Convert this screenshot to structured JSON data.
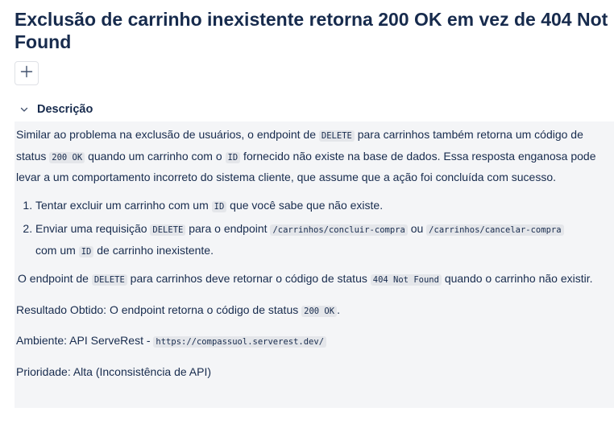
{
  "issue": {
    "title": "Exclusão de carrinho inexistente retorna 200 OK em vez de 404 Not Found"
  },
  "toolbar": {
    "add_icon": "plus-icon"
  },
  "description_section": {
    "title": "Descrição",
    "toggle_icon": "chevron-down-icon",
    "paragraph1": {
      "t1": "Similar ao problema na exclusão de usuários, o endpoint de ",
      "c1": "DELETE",
      "t2": " para carrinhos também retorna um código de status ",
      "c2": "200 OK",
      "t3": " quando um carrinho com o ",
      "c3": "ID",
      "t4": " fornecido não existe na base de dados. Essa resposta enganosa pode levar a um comportamento incorreto do sistema cliente, que assume que a ação foi concluída com sucesso."
    },
    "steps": [
      {
        "t1": "Tentar excluir um carrinho com um ",
        "c1": "ID",
        "t2": " que você sabe que não existe."
      },
      {
        "t1": "Enviar uma requisição ",
        "c1": "DELETE",
        "t2": " para o endpoint ",
        "c2": "/carrinhos/concluir-compra",
        "t3": " ou ",
        "c3": "/carrinhos/cancelar-compra",
        "t4": " com um ",
        "c4": "ID",
        "t5": " de carrinho inexistente."
      }
    ],
    "expected": {
      "t1": "O endpoint de ",
      "c1": "DELETE",
      "t2": " para carrinhos deve retornar o código de status ",
      "c2": "404 Not Found",
      "t3": " quando o carrinho não existir."
    },
    "result": {
      "t1": "Resultado Obtido: O endpoint retorna o código de status ",
      "c1": "200 OK",
      "t2": "."
    },
    "environment": {
      "t1": "Ambiente: API ServeRest - ",
      "c1": "https://compassuol.serverest.dev/"
    },
    "priority": {
      "t1": "Prioridade: Alta (Inconsistência de API)"
    }
  }
}
